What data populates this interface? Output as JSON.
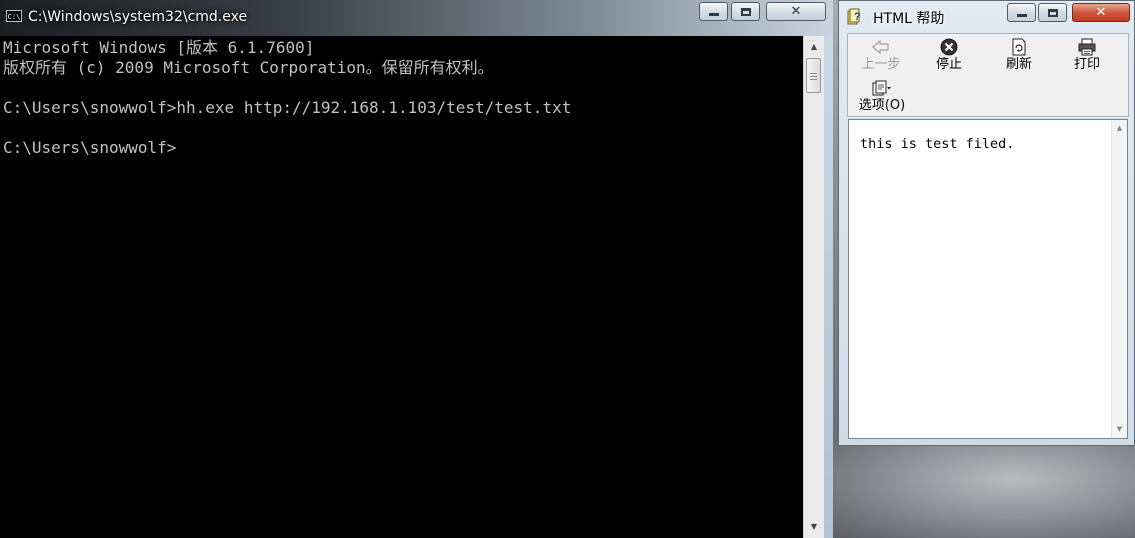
{
  "cmd": {
    "title": "C:\\Windows\\system32\\cmd.exe",
    "icon": "C:\\",
    "lines": [
      "Microsoft Windows [版本 6.1.7600]",
      "版权所有 (c) 2009 Microsoft Corporation。保留所有权利。",
      "",
      "C:\\Users\\snowwolf>hh.exe http://192.168.1.103/test/test.txt",
      "",
      "C:\\Users\\snowwolf>"
    ],
    "text_color": "#c0c0c0",
    "bg_color": "#000000"
  },
  "help": {
    "title": "HTML 帮助",
    "toolbar": {
      "back": "上一步",
      "stop": "停止",
      "refresh": "刷新",
      "print": "打印",
      "options": "选项(O)"
    },
    "content": "this is test filed."
  },
  "icons": {
    "cmd": "console-icon",
    "help": "help-icon",
    "back": "back-arrow-icon",
    "stop": "stop-icon",
    "refresh": "refresh-icon",
    "print": "printer-icon",
    "options": "options-icon"
  }
}
